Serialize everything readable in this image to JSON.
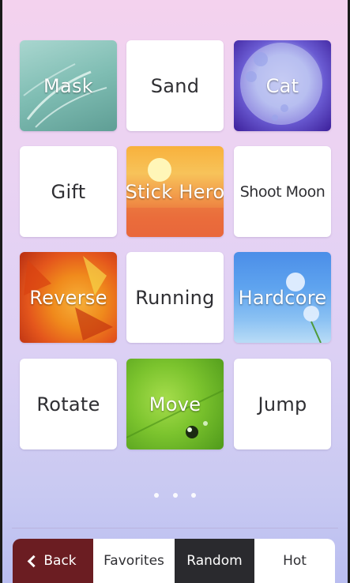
{
  "tiles": [
    {
      "label": "Mask",
      "style": "photo",
      "bg": "mask"
    },
    {
      "label": "Sand",
      "style": "plain"
    },
    {
      "label": "Cat",
      "style": "photo",
      "bg": "cat"
    },
    {
      "label": "Gift",
      "style": "plain"
    },
    {
      "label": "Stick Hero",
      "style": "photo",
      "bg": "stick"
    },
    {
      "label": "Shoot Moon",
      "style": "plain"
    },
    {
      "label": "Reverse",
      "style": "photo",
      "bg": "reverse"
    },
    {
      "label": "Running",
      "style": "plain"
    },
    {
      "label": "Hardcore",
      "style": "photo",
      "bg": "hardcore"
    },
    {
      "label": "Rotate",
      "style": "plain"
    },
    {
      "label": "Move",
      "style": "photo",
      "bg": "move"
    },
    {
      "label": "Jump",
      "style": "plain"
    }
  ],
  "pagination": {
    "count": 3,
    "active_index": 1
  },
  "tabbar": {
    "back_label": "Back",
    "favorites_label": "Favorites",
    "random_label": "Random",
    "hot_label": "Hot"
  },
  "colors": {
    "back_bg": "#6b1d22",
    "random_bg": "#2a2a2e",
    "background_top": "#f4d2ee",
    "background_bottom": "#b9bdf0"
  }
}
